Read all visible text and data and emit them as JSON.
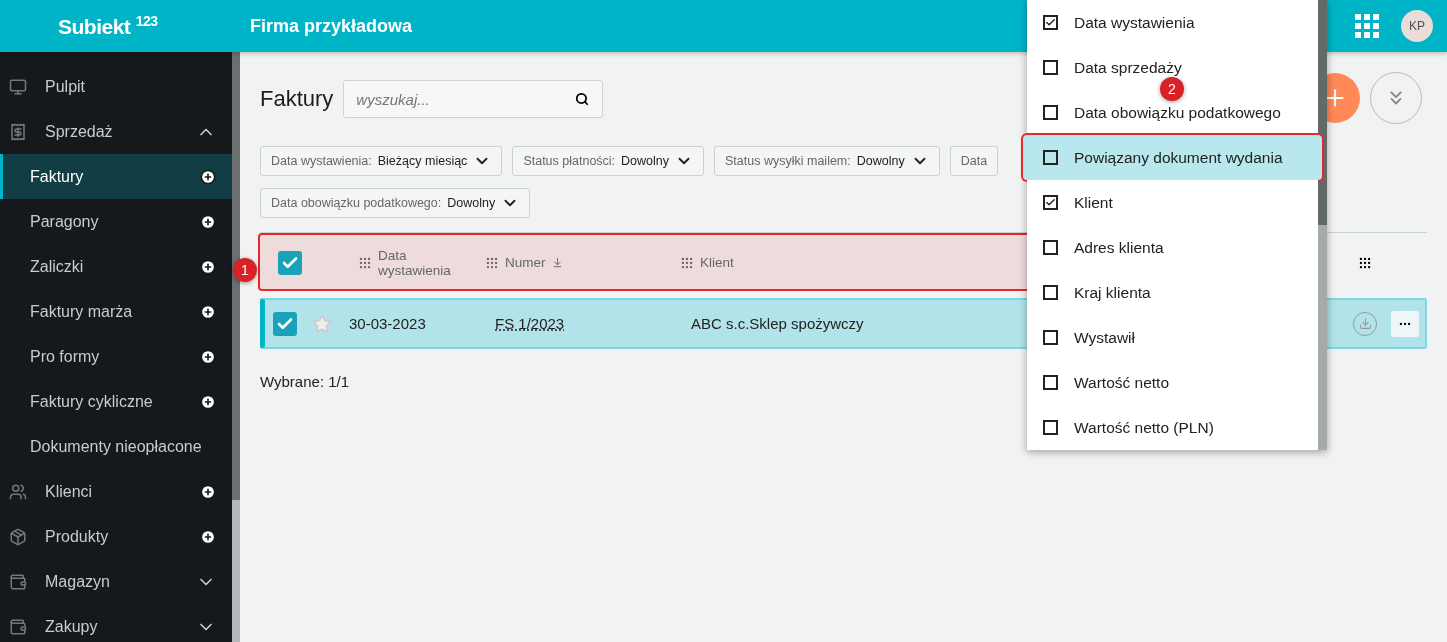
{
  "header": {
    "logo": "Subiekt",
    "logo_sup": "123",
    "company": "Firma przykładowa",
    "avatar": "KP"
  },
  "sidebar": {
    "items": [
      {
        "label": "Pulpit",
        "kind": "section",
        "selected": false
      },
      {
        "label": "Sprzedaż",
        "kind": "section-toggle",
        "expanded": true,
        "selected": false
      },
      {
        "label": "Faktury",
        "kind": "subitem-add",
        "selected": true
      },
      {
        "label": "Paragony",
        "kind": "subitem-add",
        "selected": false
      },
      {
        "label": "Zaliczki",
        "kind": "subitem-add",
        "selected": false
      },
      {
        "label": "Faktury marża",
        "kind": "subitem-add",
        "selected": false
      },
      {
        "label": "Pro formy",
        "kind": "subitem-add",
        "selected": false
      },
      {
        "label": "Faktury cykliczne",
        "kind": "subitem-add",
        "selected": false
      },
      {
        "label": "Dokumenty nieopłacone",
        "kind": "subitem",
        "selected": false
      },
      {
        "label": "Klienci",
        "kind": "section-add",
        "selected": false
      },
      {
        "label": "Produkty",
        "kind": "section-add",
        "selected": false
      },
      {
        "label": "Magazyn",
        "kind": "section-toggle",
        "expanded": false,
        "selected": false
      },
      {
        "label": "Zakupy",
        "kind": "section-toggle",
        "expanded": false,
        "selected": false
      }
    ]
  },
  "page": {
    "title": "Faktury",
    "search": {
      "placeholder": "wyszukaj..."
    }
  },
  "filters": [
    [
      {
        "label": "Data wystawienia:",
        "value": "Bieżący miesiąc"
      },
      {
        "label": "Status płatności:",
        "value": "Dowolny"
      },
      {
        "label": "Status wysyłki mailem:",
        "value": "Dowolny"
      },
      {
        "label": "Data"
      }
    ],
    [
      {
        "label": "Data obowiązku podatkowego:",
        "value": "Dowolny"
      }
    ]
  ],
  "table": {
    "select_all": {
      "checked": true
    },
    "columns": [
      {
        "label": "Data wystawienia"
      },
      {
        "label": "Numer",
        "sortable": true
      },
      {
        "label": "Klient"
      }
    ],
    "rows": [
      {
        "checked": true,
        "starred": false,
        "date": "30-03-2023",
        "number": "FS 1/2023",
        "client": "ABC s.c.Sklep spożywczy"
      }
    ]
  },
  "selection": "Wybrane: 1/1",
  "column_menu": {
    "items": [
      {
        "label": "Data wystawienia",
        "checked": true,
        "highlighted": false
      },
      {
        "label": "Data sprzedaży",
        "checked": false,
        "highlighted": false
      },
      {
        "label": "Data obowiązku podatkowego",
        "checked": false,
        "highlighted": false
      },
      {
        "label": "Powiązany dokument wydania",
        "checked": false,
        "highlighted": true
      },
      {
        "label": "Klient",
        "checked": true,
        "highlighted": false
      },
      {
        "label": "Adres klienta",
        "checked": false,
        "highlighted": false
      },
      {
        "label": "Kraj klienta",
        "checked": false,
        "highlighted": false
      },
      {
        "label": "Wystawił",
        "checked": false,
        "highlighted": false
      },
      {
        "label": "Wartość netto",
        "checked": false,
        "highlighted": false
      },
      {
        "label": "Wartość netto (PLN)",
        "checked": false,
        "highlighted": false
      }
    ]
  },
  "callouts": [
    {
      "text": "1"
    },
    {
      "text": "2"
    }
  ]
}
